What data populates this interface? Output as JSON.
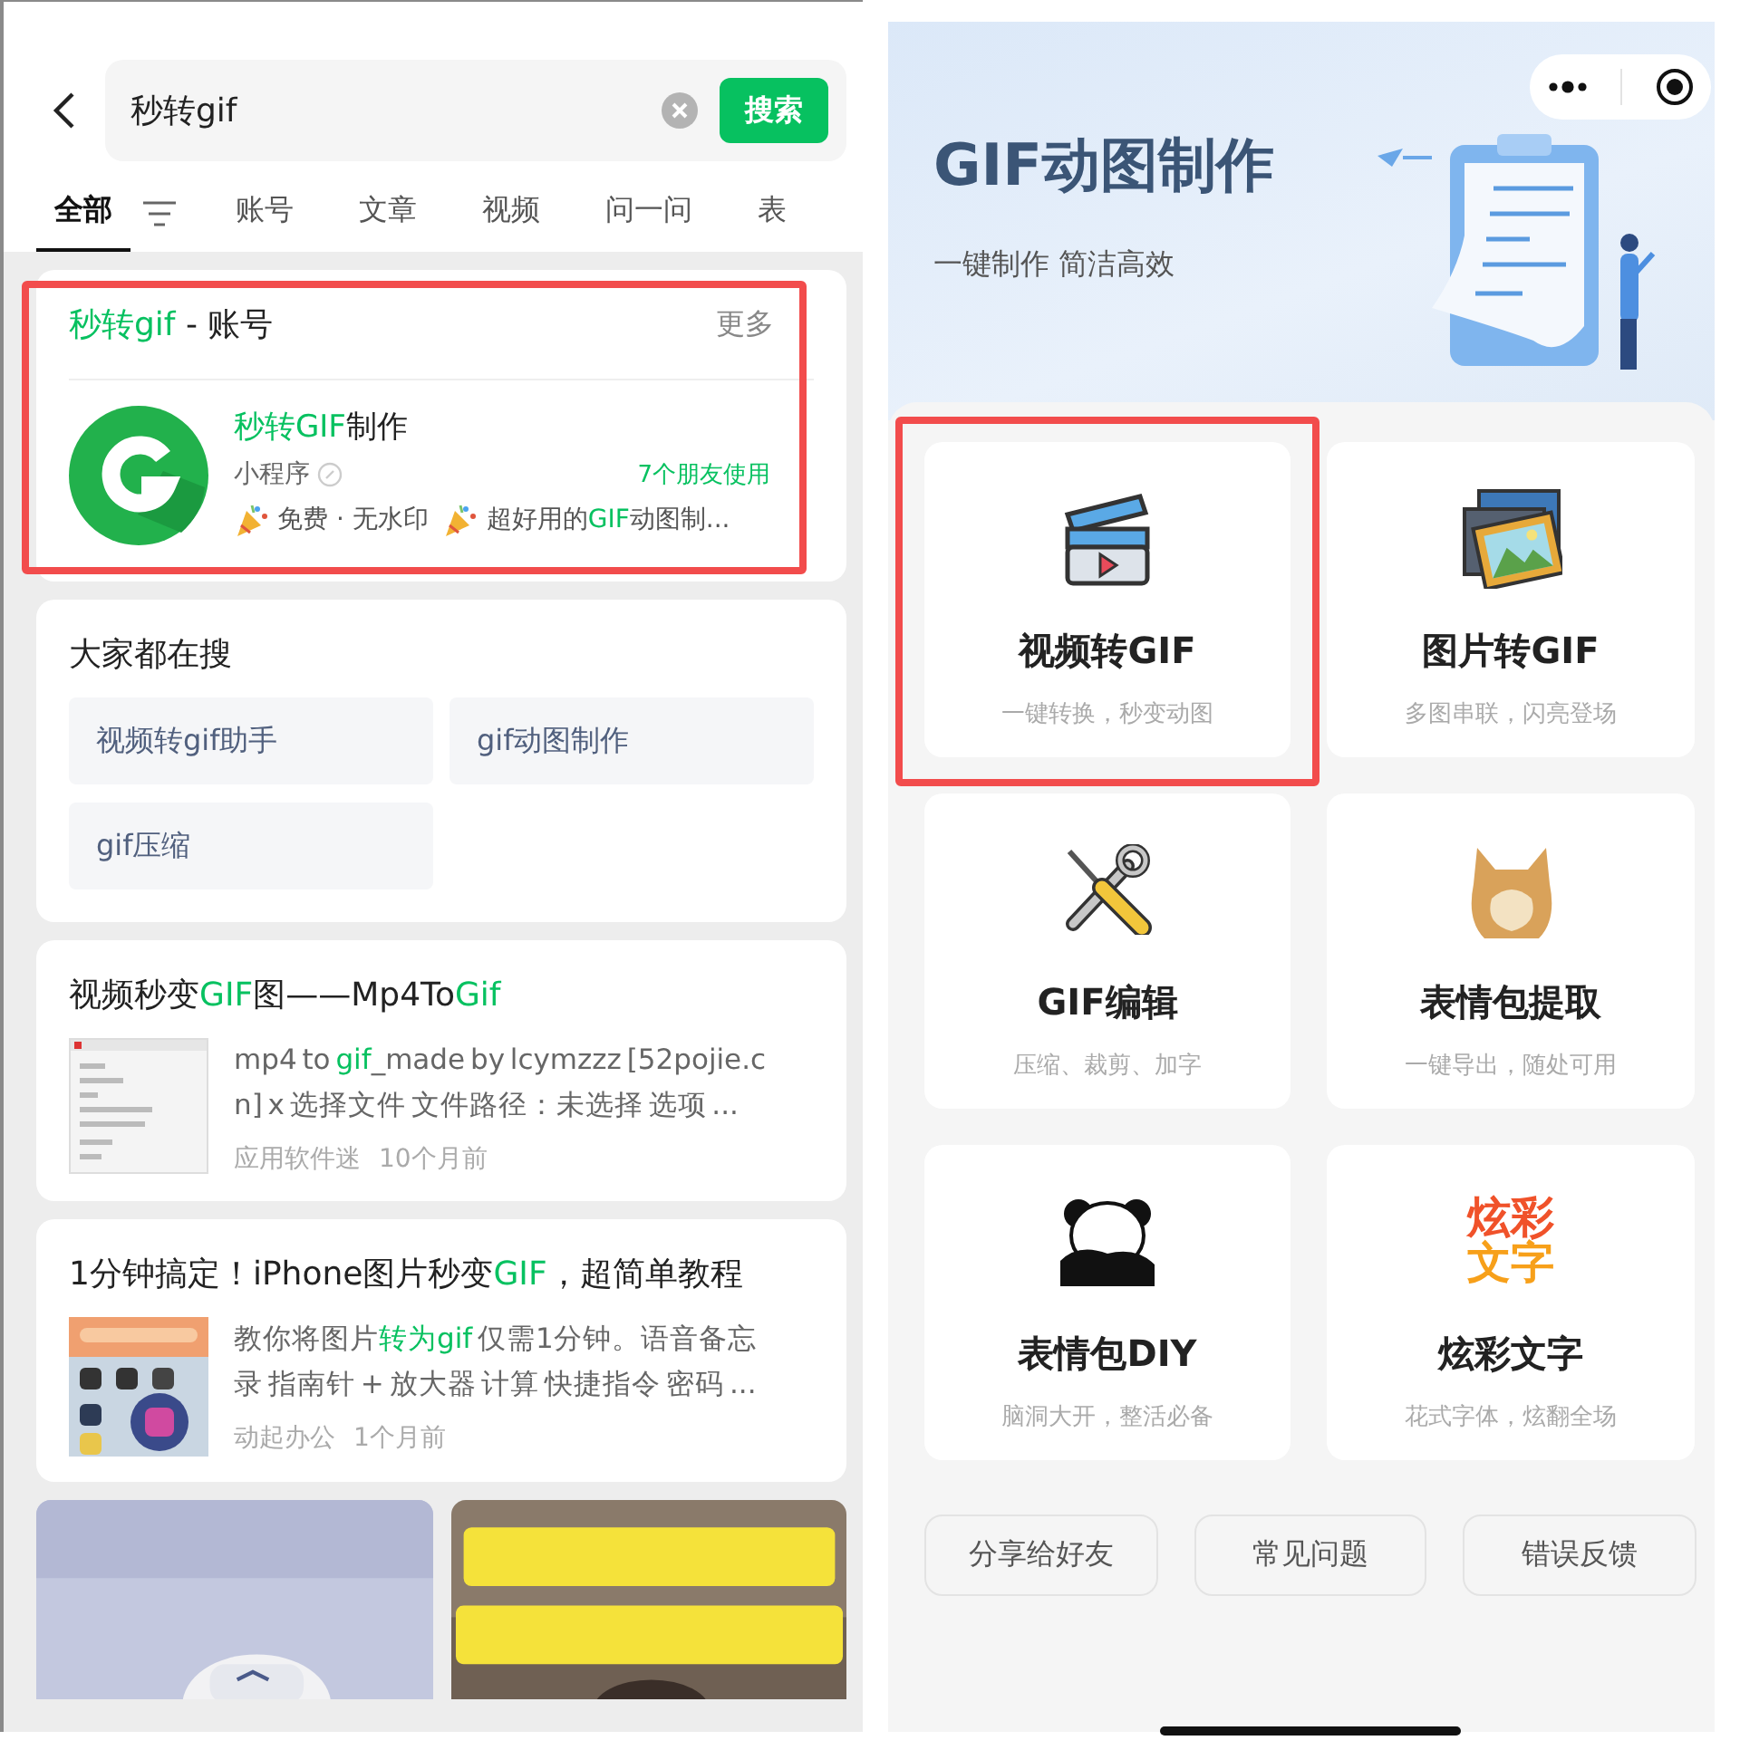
{
  "search": {
    "query": "秒转gif",
    "button": "搜索"
  },
  "tabs": [
    {
      "label": "全部",
      "selected": true
    },
    {
      "label": "账号",
      "selected": false
    },
    {
      "label": "文章",
      "selected": false
    },
    {
      "label": "视频",
      "selected": false
    },
    {
      "label": "问一问",
      "selected": false
    },
    {
      "label": "表",
      "selected": false
    }
  ],
  "account_card": {
    "title": "**秒转gif** - 账号",
    "more": "更多",
    "highlighted": true,
    "app": {
      "name": "**秒转GIF**制作",
      "type": "小程序",
      "friends": "7个朋友使用",
      "tags": [
        "免费 · 无水印",
        "超好用的**GIF**动图制..."
      ]
    }
  },
  "trending": {
    "title": "大家都在搜",
    "chips": [
      "视频转gif助手",
      "gif动图制作",
      "gif压缩"
    ]
  },
  "articles": [
    {
      "title": "视频秒变**GIF**图——Mp4To**Gif**",
      "snippet": "mp4 to **gif**_made by lcymzzz [52pojie.cn] x 选择文件 文件路径：未选择 选项 ...",
      "source": "应用软件迷",
      "time": "10个月前"
    },
    {
      "title": "1分钟搞定！iPhone图片秒变**GIF**，超简单教程",
      "snippet": "教你将图片**转为gif** 仅需1分钟。语音备忘录 指南针 + 放大器 计算 快捷指令 密码 ...",
      "source": "动起办公",
      "time": "1个月前"
    }
  ],
  "mini_app": {
    "title": "GIF动图制作",
    "subtitle": "一键制作 简洁高效",
    "tile_rows": [
      [
        {
          "title": "视频转GIF",
          "subtitle": "一键转换，秒变动图",
          "highlighted": true
        },
        {
          "title": "图片转GIF",
          "subtitle": "多图串联，闪亮登场",
          "highlighted": false
        }
      ],
      [
        {
          "title": "GIF编辑",
          "subtitle": "压缩、裁剪、加字",
          "highlighted": false
        },
        {
          "title": "表情包提取",
          "subtitle": "一键导出，随处可用",
          "highlighted": false
        }
      ],
      [
        {
          "title": "表情包DIY",
          "subtitle": "脑洞大开，整活必备",
          "highlighted": false
        },
        {
          "title": "炫彩文字",
          "subtitle": "花式字体，炫翻全场",
          "highlighted": false,
          "icon_lines": [
            "炫彩",
            "文字"
          ]
        }
      ]
    ],
    "buttons": [
      "分享给好友",
      "常见问题",
      "错误反馈"
    ]
  }
}
